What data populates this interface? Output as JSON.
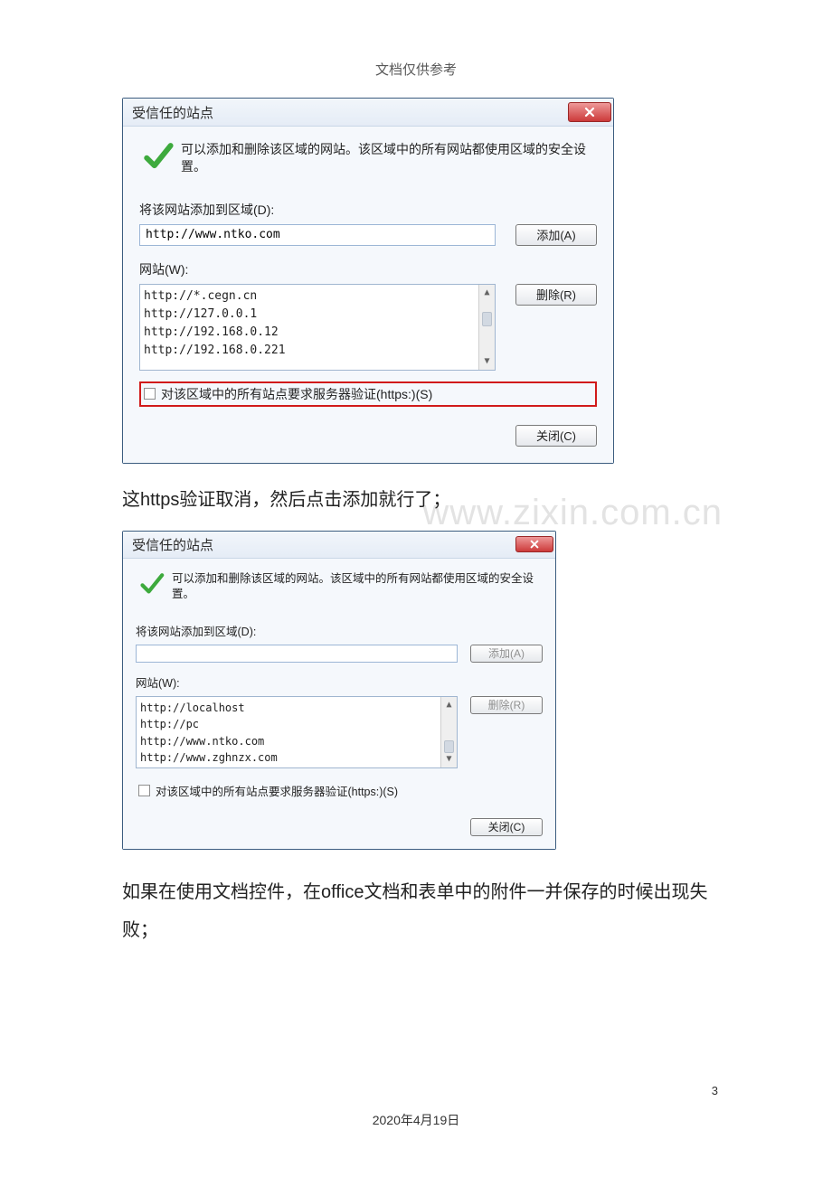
{
  "header": {
    "text": "文档仅供参考"
  },
  "dialog1": {
    "title": "受信任的站点",
    "intro": "可以添加和删除该区域的网站。该区域中的所有网站都使用区域的安全设置。",
    "label_add": "将该网站添加到区域(D):",
    "input_value": "http://www.ntko.com",
    "btn_add": "添加(A)",
    "label_sites": "网站(W):",
    "sites": [
      "http://*.cegn.cn",
      "http://127.0.0.1",
      "http://192.168.0.12",
      "http://192.168.0.221"
    ],
    "btn_remove": "删除(R)",
    "checkbox_label": "对该区域中的所有站点要求服务器验证(https:)(S)",
    "btn_close": "关闭(C)"
  },
  "instruction1": "这https验证取消，然后点击添加就行了；",
  "watermark": "www.zixin.com.cn",
  "dialog2": {
    "title": "受信任的站点",
    "intro": "可以添加和删除该区域的网站。该区域中的所有网站都使用区域的安全设置。",
    "label_add": "将该网站添加到区域(D):",
    "input_value": "",
    "btn_add": "添加(A)",
    "label_sites": "网站(W):",
    "sites": [
      "http://localhost",
      "http://pc",
      "http://www.ntko.com",
      "http://www.zghnzx.com"
    ],
    "btn_remove": "删除(R)",
    "checkbox_label": "对该区域中的所有站点要求服务器验证(https:)(S)",
    "btn_close": "关闭(C)"
  },
  "bottom_para": "如果在使用文档控件，在office文档和表单中的附件一并保存的时候出现失败；",
  "page_number": "3",
  "footer_date": "2020年4月19日"
}
